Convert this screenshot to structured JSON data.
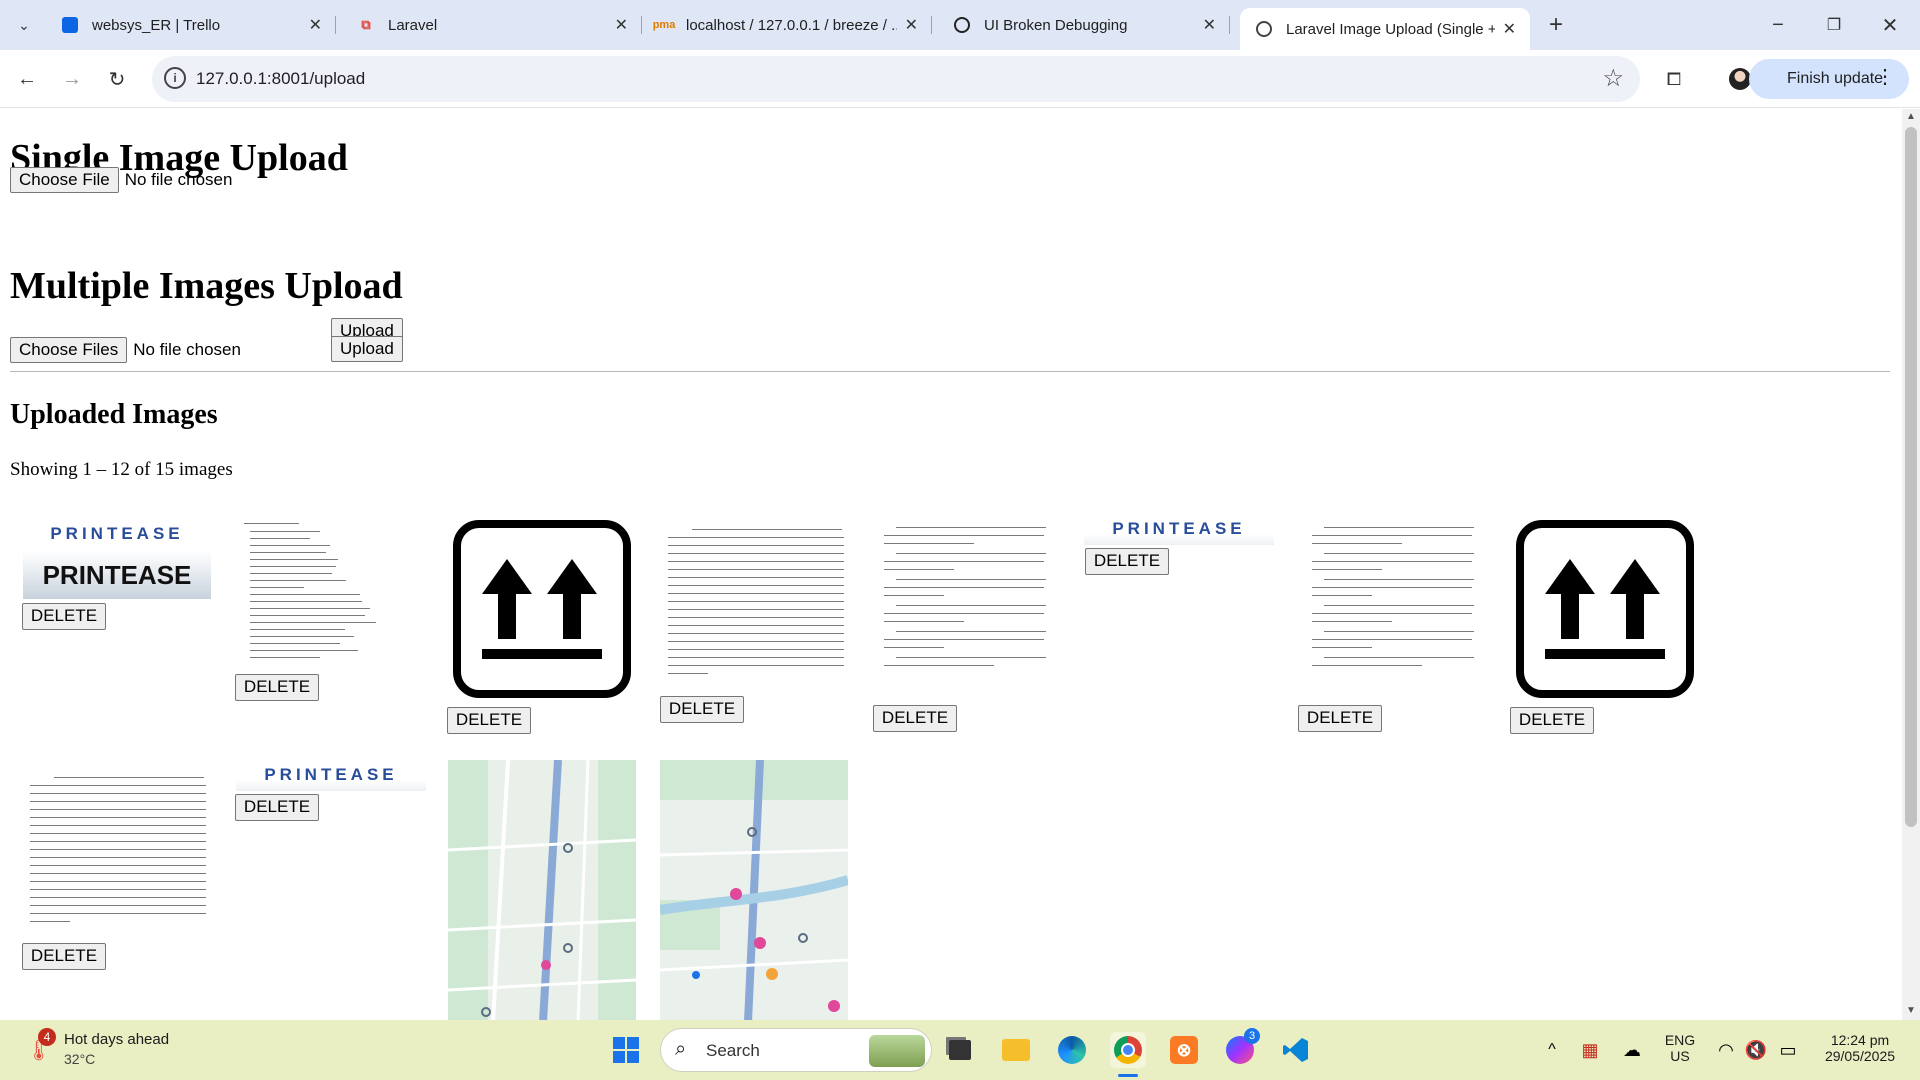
{
  "browser": {
    "tabs": [
      {
        "title": "websys_ER | Trello",
        "icon": "trello-icon"
      },
      {
        "title": "Laravel",
        "icon": "laravel-icon"
      },
      {
        "title": "localhost / 127.0.0.1 / breeze / ...",
        "icon": "phpmyadmin-icon"
      },
      {
        "title": "UI Broken Debugging",
        "icon": "chatgpt-icon"
      },
      {
        "title": "Laravel Image Upload (Single + ...",
        "icon": "globe-icon"
      }
    ],
    "url": "127.0.0.1:8001/upload",
    "finish_update_label": "Finish update"
  },
  "page": {
    "single_heading": "Single Image Upload",
    "single_choose_label": "Choose File",
    "single_file_status": "No file chosen",
    "upload_label": "Upload",
    "multiple_heading": "Multiple Images Upload",
    "multiple_choose_label": "Choose Files",
    "multiple_file_status": "No file chosen",
    "uploaded_heading": "Uploaded Images",
    "showing_text": "Showing 1 – 12 of 15 images",
    "delete_label": "DELETE",
    "printease_text": "PRINTEASE",
    "images": [
      {
        "kind": "printease-banner"
      },
      {
        "kind": "questions-document"
      },
      {
        "kind": "this-side-up-icon"
      },
      {
        "kind": "text-document"
      },
      {
        "kind": "text-document"
      },
      {
        "kind": "printease-logo"
      },
      {
        "kind": "text-document"
      },
      {
        "kind": "this-side-up-icon"
      },
      {
        "kind": "text-document"
      },
      {
        "kind": "printease-logo"
      },
      {
        "kind": "map"
      },
      {
        "kind": "map"
      }
    ]
  },
  "taskbar": {
    "weather_title": "Hot days ahead",
    "weather_temp": "32°C",
    "weather_badge": "4",
    "search_label": "Search",
    "messenger_badge": "3",
    "lang_top": "ENG",
    "lang_bottom": "US",
    "time": "12:24 pm",
    "date": "29/05/2025"
  }
}
